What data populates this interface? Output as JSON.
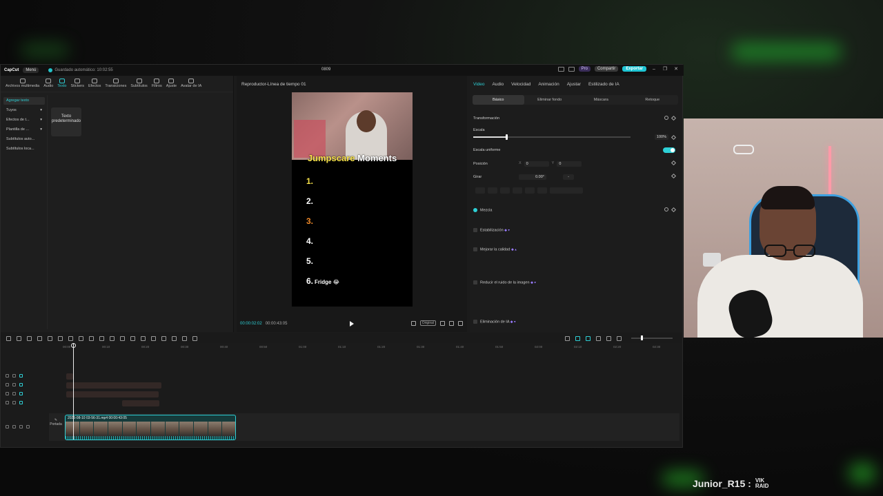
{
  "app": {
    "logo": "CapCut",
    "menu_label": "Menú",
    "autosave": "Guardado automático: 10:02:55",
    "project_name": "0809",
    "pro_label": "Pro",
    "share_label": "Compartir",
    "export_label": "Exportar"
  },
  "media_toolbar": {
    "items": [
      {
        "label": "Archivos multimedia",
        "icon": "media-icon"
      },
      {
        "label": "Audio",
        "icon": "audio-icon"
      },
      {
        "label": "Texto",
        "icon": "text-icon"
      },
      {
        "label": "Stickers",
        "icon": "sticker-icon"
      },
      {
        "label": "Efectos",
        "icon": "effects-icon"
      },
      {
        "label": "Transiciones",
        "icon": "transition-icon"
      },
      {
        "label": "Subtítulos",
        "icon": "subtitle-icon"
      },
      {
        "label": "Filtros",
        "icon": "filter-icon"
      },
      {
        "label": "Ajuste",
        "icon": "adjust-icon"
      },
      {
        "label": "Avatar de IA",
        "icon": "avatar-icon"
      }
    ]
  },
  "text_sidebar": {
    "items": [
      {
        "label": "Agregar texto"
      },
      {
        "label": "Tuyos"
      },
      {
        "label": "Efectos de t..."
      },
      {
        "label": "Plantilla de ..."
      },
      {
        "label": "Subtítulos auto..."
      },
      {
        "label": "Subtítulos loca..."
      }
    ],
    "card": "Texto predeterminado"
  },
  "player": {
    "title": "Reproductor-Línea de tiempo 01",
    "current_time": "00:00:02:02",
    "total_time": "00:00:43:05",
    "ratio_label": "Original",
    "video": {
      "title_yellow": "Jumpscare",
      "title_white": "Moments",
      "ranks": [
        "1.",
        "2.",
        "3.",
        "4.",
        "5.",
        "6."
      ],
      "rank6_text": "Fridge 😂"
    }
  },
  "properties": {
    "tabs": [
      "Video",
      "Audio",
      "Velocidad",
      "Animación",
      "Ajustar",
      "Estilizado de IA"
    ],
    "sub_tabs": [
      "Básico",
      "Eliminar fondo",
      "Máscara",
      "Retoque"
    ],
    "transform_label": "Transformación",
    "scale_label": "Escala",
    "scale_value": "100%",
    "scale_fraction": 0.22,
    "uniform_scale_label": "Escala uniforme",
    "position_label": "Posición",
    "pos_x_label": "X",
    "pos_x_value": "0",
    "pos_y_label": "Y",
    "pos_y_value": "0",
    "rotate_label": "Girar",
    "rotate_value": "0.00°",
    "rotate_dash": "-",
    "blend_label": "Mezcla",
    "stabilize_label": "Estabilización",
    "enhance_label": "Mejorar la calidad",
    "denoise_label": "Reducir el ruido de la imagen",
    "ai_remove_label": "Eliminación de IA"
  },
  "timeline": {
    "ticks": [
      "00:00",
      "00:10",
      "00:20",
      "00:30",
      "00:40",
      "00:50",
      "01:00",
      "01:10",
      "01:20",
      "01:30",
      "01:40",
      "01:50",
      "02:00",
      "02:10",
      "02:20",
      "02:30"
    ],
    "cover_label": "Portada",
    "clip_label": "2025-08-10 03-56-31.mp4  00:00:43:05"
  },
  "overlay": {
    "raid_name": "Junior_R15 :",
    "raid_tag_1": "VIK",
    "raid_tag_2": "RAID"
  },
  "colors": {
    "accent": "#2ed0d6",
    "export": "#1fc5d4",
    "title_yellow": "#f5e04a",
    "rank_orange": "#f08a2a"
  }
}
